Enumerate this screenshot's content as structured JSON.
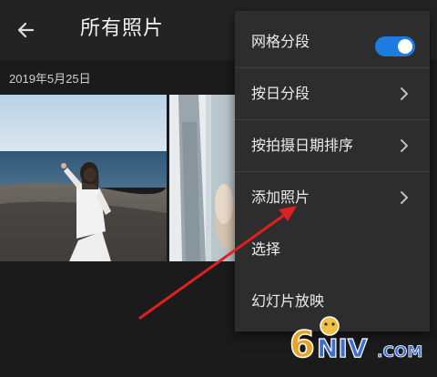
{
  "appbar": {
    "title": "所有照片",
    "back_icon": "arrow-left-icon"
  },
  "section": {
    "date": "2019年5月25日"
  },
  "menu": {
    "items": [
      {
        "label": "网格分段",
        "control": "toggle",
        "toggle_on": true
      },
      {
        "label": "按日分段",
        "control": "chevron"
      },
      {
        "label": "按拍摄日期排序",
        "control": "chevron"
      },
      {
        "label": "添加照片",
        "control": "chevron"
      },
      {
        "label": "选择",
        "control": "none"
      },
      {
        "label": "幻灯片放映",
        "control": "none"
      }
    ]
  },
  "colors": {
    "toggle_accent": "#1e7be0",
    "annotation_arrow": "#e02020",
    "menu_bg": "#2d2d2d"
  },
  "watermark": {
    "text": "6NIV.COM"
  }
}
